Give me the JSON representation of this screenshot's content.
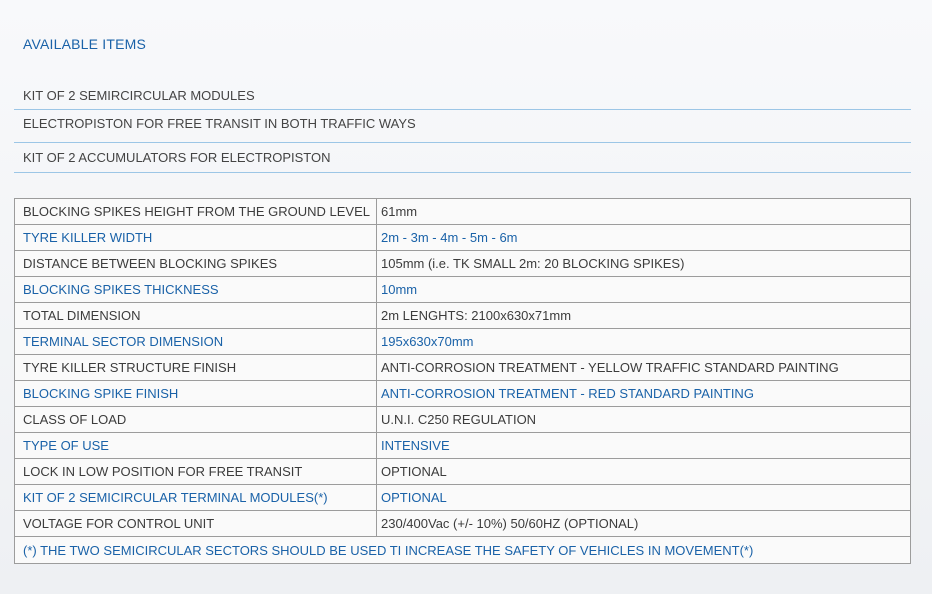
{
  "available_items": {
    "heading": "AVAILABLE ITEMS",
    "items": [
      "KIT OF 2 SEMIRCIRCULAR MODULES",
      "ELECTROPISTON FOR FREE TRANSIT IN BOTH TRAFFIC WAYS",
      "KIT OF 2 ACCUMULATORS FOR ELECTROPISTON"
    ]
  },
  "specs": {
    "rows": [
      {
        "label": "BLOCKING SPIKES HEIGHT FROM THE GROUND LEVEL",
        "value": "61mm"
      },
      {
        "label": "TYRE KILLER WIDTH",
        "value": "2m - 3m - 4m - 5m - 6m"
      },
      {
        "label": "DISTANCE BETWEEN BLOCKING SPIKES",
        "value": "105mm (i.e. TK SMALL 2m: 20 BLOCKING SPIKES)"
      },
      {
        "label": "BLOCKING SPIKES THICKNESS",
        "value": "10mm"
      },
      {
        "label": "TOTAL DIMENSION",
        "value": "2m LENGHTS: 2100x630x71mm"
      },
      {
        "label": "TERMINAL SECTOR DIMENSION",
        "value": "195x630x70mm"
      },
      {
        "label": "TYRE KILLER STRUCTURE FINISH",
        "value": "ANTI-CORROSION TREATMENT - YELLOW TRAFFIC STANDARD PAINTING"
      },
      {
        "label": "BLOCKING SPIKE FINISH",
        "value": "ANTI-CORROSION TREATMENT - RED STANDARD PAINTING"
      },
      {
        "label": "CLASS OF LOAD",
        "value": "U.N.I. C250 REGULATION"
      },
      {
        "label": "TYPE OF USE",
        "value": "INTENSIVE"
      },
      {
        "label": "LOCK IN LOW POSITION FOR FREE TRANSIT",
        "value": "OPTIONAL"
      },
      {
        "label": "KIT OF 2 SEMICIRCULAR TERMINAL MODULES(*)",
        "value": "OPTIONAL"
      },
      {
        "label": "VOLTAGE FOR CONTROL UNIT",
        "value": "230/400Vac (+/- 10%) 50/60HZ (OPTIONAL)"
      }
    ],
    "footnote": "(*) THE TWO SEMICIRCULAR SECTORS SHOULD BE USED TI INCREASE THE SAFETY OF VEHICLES IN MOVEMENT(*)"
  },
  "colors": {
    "accent_blue": "#1a62a8",
    "divider_blue": "#9cc6e6",
    "table_border": "#9c9c9c",
    "text_gray": "#3c3c3c"
  }
}
